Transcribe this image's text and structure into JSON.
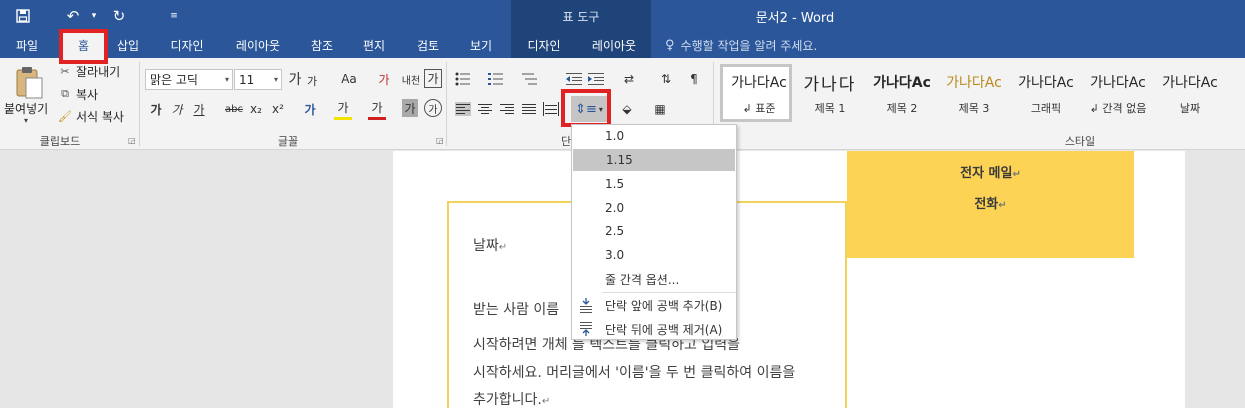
{
  "titlebar": {
    "contextual_tab_group": "표 도구",
    "document_title": "문서2 - Word"
  },
  "tabs": [
    {
      "label": "파일"
    },
    {
      "label": "홈"
    },
    {
      "label": "삽입"
    },
    {
      "label": "디자인"
    },
    {
      "label": "레이아웃"
    },
    {
      "label": "참조"
    },
    {
      "label": "편지"
    },
    {
      "label": "검토"
    },
    {
      "label": "보기"
    },
    {
      "label": "디자인"
    },
    {
      "label": "레이아웃"
    }
  ],
  "tell_me": "수행할 작업을 알려 주세요.",
  "clipboard": {
    "paste_label": "붙여넣기",
    "cut_label": "잘라내기",
    "copy_label": "복사",
    "format_painter_label": "서식 복사",
    "group_label": "클립보드"
  },
  "font": {
    "font_name": "맑은 고딕",
    "font_size": "11",
    "grow_label": "가",
    "shrink_label": "가",
    "case_label": "Aa",
    "clear_label": "가",
    "phonetic_label": "내천",
    "border_label": "가",
    "bold_label": "가",
    "italic_label": "가",
    "underline_label": "가",
    "strike_label": "abc",
    "subscript_label": "x₂",
    "superscript_label": "x²",
    "effects_label": "가",
    "highlight_label": "가",
    "color_label": "가",
    "shading_label": "가",
    "enclose_label": "가",
    "group_label": "글꼴"
  },
  "paragraph": {
    "group_label": "단"
  },
  "styles": {
    "group_label": "스타일",
    "items": [
      {
        "sample": "가나다Ac",
        "name": "↲ 표준"
      },
      {
        "sample": "가나다",
        "name": "제목 1"
      },
      {
        "sample": "가나다Ac",
        "name": "제목 2"
      },
      {
        "sample": "가나다Ac",
        "name": "제목 3"
      },
      {
        "sample": "가나다Ac",
        "name": "그래픽"
      },
      {
        "sample": "가나다Ac",
        "name": "↲ 간격 없음"
      },
      {
        "sample": "가나다Ac",
        "name": "날짜"
      }
    ]
  },
  "line_spacing_menu": {
    "options": [
      "1.0",
      "1.15",
      "1.5",
      "2.0",
      "2.5",
      "3.0"
    ],
    "selected": "1.15",
    "more_options": "줄 간격 옵션...",
    "add_space_before": "단락 앞에 공백 추가(B)",
    "remove_space_after": "단락 뒤에 공백 제거(A)"
  },
  "document": {
    "contact_email": "전자 메일",
    "contact_phone": "전화",
    "date_text": "날짜",
    "recipient_text": "받는 사람 이름",
    "body_line_1": "시작하려면 개체 틀 텍스트를 클릭하고 입력을",
    "body_line_2": "시작하세요. 머리글에서 '이름'을 두 번 클릭하여 이름을",
    "body_line_3": "추가합니다.",
    "paragraph_mark": "↵"
  },
  "colors": {
    "title_bar": "#2b579a",
    "contextual": "#1f4479",
    "highlight_box": "#e02222",
    "contact_block": "#fcd354",
    "frame_border": "#f2d35a"
  }
}
